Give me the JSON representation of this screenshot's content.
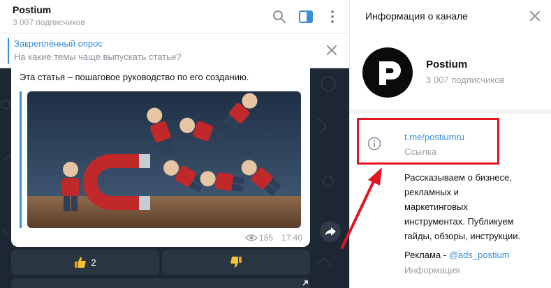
{
  "chat": {
    "title": "Postium",
    "subscribers": "3 007 подписчиков",
    "header_icons": [
      "search-icon",
      "sidebar-toggle-icon",
      "more-vertical-icon"
    ],
    "pinned": {
      "title": "Закреплённый опрос",
      "text": "На какие темы чаще выпускать статьи?"
    },
    "message": {
      "text": "Эта статья – пошаговое руководство по его созданию.",
      "views": "185",
      "time": "17:40"
    },
    "reactions": {
      "like_count": "2"
    }
  },
  "info": {
    "title": "Информация о канале",
    "channel_name": "Postium",
    "subscribers": "3 007 подписчиков",
    "link": "t.me/postiumru",
    "link_label": "Ссылка",
    "about_lines": [
      "Рассказываем о бизнесе,",
      "рекламных и",
      "маркетинговых",
      "инструментах. Публикуем",
      "гайды, обзоры, инструкции."
    ],
    "ads_prefix": "Реклама - ",
    "ads_handle": "@ads_postium",
    "ads_label": "Информация"
  },
  "colors": {
    "accent": "#3a8ed7",
    "chat_background": "#1d2733",
    "annotation_red": "#e2141f"
  }
}
